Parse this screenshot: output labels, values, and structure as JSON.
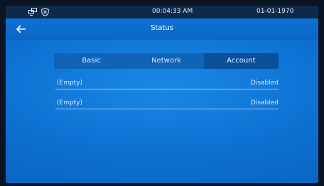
{
  "statusbar": {
    "icons": [
      "network-icon",
      "shield-icon"
    ],
    "time": "00:04:33   AM",
    "date": "01-01-1970"
  },
  "header": {
    "back_icon": "arrow-left-icon",
    "title": "Status"
  },
  "tabs": [
    {
      "label": "Basic"
    },
    {
      "label": "Network"
    },
    {
      "label": "Account",
      "active": true
    }
  ],
  "accounts": [
    {
      "name": "(Empty)",
      "state": "Disabled"
    },
    {
      "name": "(Empty)",
      "state": "Disabled"
    }
  ]
}
